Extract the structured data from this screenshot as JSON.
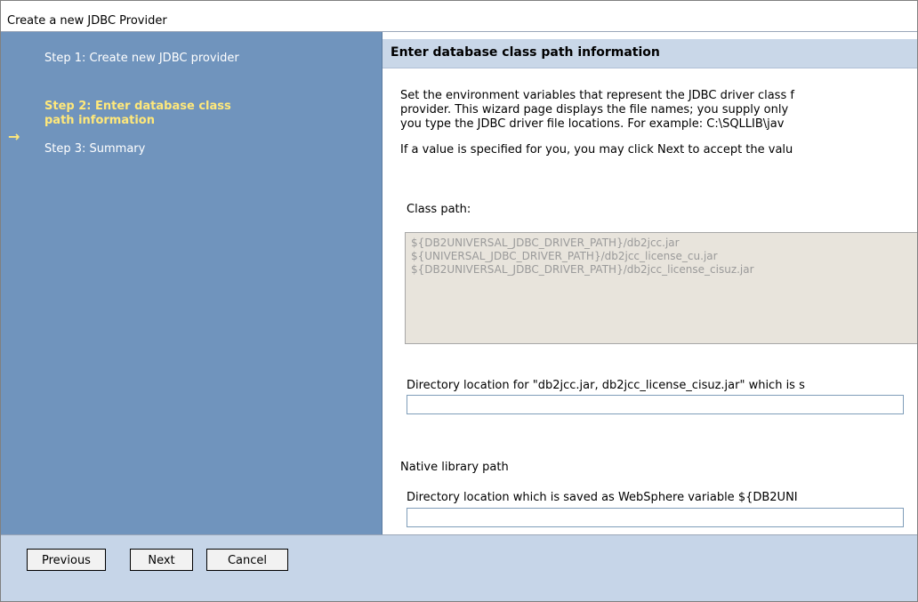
{
  "window": {
    "title": "Create a new JDBC Provider"
  },
  "sidebar": {
    "steps": [
      {
        "label": "Step 1: Create new JDBC provider"
      },
      {
        "label": "Step 2: Enter database class path information",
        "current": true
      },
      {
        "label": "Step 3: Summary"
      }
    ],
    "current_indicator": "→"
  },
  "main": {
    "header": "Enter database class path information",
    "intro_lines": [
      "Set the environment variables that represent the JDBC driver class f",
      "provider. This wizard page displays the file names; you supply only",
      "you type the JDBC driver file locations. For example: C:\\SQLLIB\\jav"
    ],
    "note": "If a value is specified for you, you may click Next to accept the valu",
    "class_path": {
      "label": "Class path:",
      "lines": [
        "${DB2UNIVERSAL_JDBC_DRIVER_PATH}/db2jcc.jar",
        "${UNIVERSAL_JDBC_DRIVER_PATH}/db2jcc_license_cu.jar",
        "${DB2UNIVERSAL_JDBC_DRIVER_PATH}/db2jcc_license_cisuz.jar"
      ]
    },
    "directory_field": {
      "label": "Directory location for \"db2jcc.jar, db2jcc_license_cisuz.jar\" which is s",
      "value": ""
    },
    "native_library": {
      "heading": "Native library path",
      "label": "Directory location which is saved as WebSphere variable ${DB2UNI",
      "value": ""
    }
  },
  "footer": {
    "previous_label": "Previous",
    "next_label": "Next",
    "cancel_label": "Cancel"
  },
  "colors": {
    "sidebar_bg": "#7094bd",
    "current_step": "#ffe87a",
    "header_bg": "#c9d7e8",
    "footer_bg": "#c6d5e8"
  }
}
